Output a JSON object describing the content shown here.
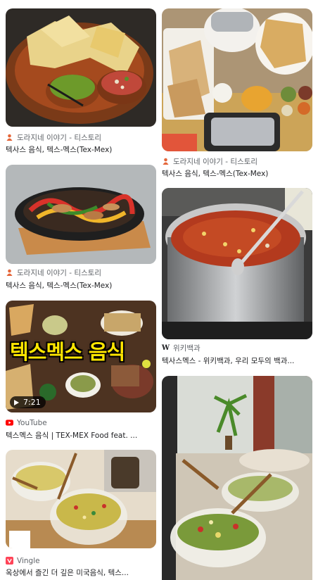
{
  "results": [
    {
      "source": "도라지네 이야기 - 티스토리",
      "title": "텍사스 음식, 텍스-멕스(Tex-Mex)",
      "favicon": "tistory-icon"
    },
    {
      "source": "도라지네 이야기 - 티스토리",
      "title": "텍사스 음식, 텍스-멕스(Tex-Mex)",
      "favicon": "tistory-icon"
    },
    {
      "source": "도라지네 이야기 - 티스토리",
      "title": "텍사스 음식, 텍스-멕스(Tex-Mex)",
      "favicon": "tistory-icon"
    },
    {
      "source": "위키백과",
      "title": "텍사스멕스 - 위키백과, 우리 모두의 백과...",
      "favicon": "wikipedia-icon",
      "favicon_glyph": "W"
    },
    {
      "source": "YouTube",
      "title": "텍스멕스 음식 | TEX-MEX Food feat. ...",
      "favicon": "youtube-icon",
      "duration": "7:21",
      "overlay_text": "텍스멕스 음식"
    },
    {
      "source": "Vingle",
      "title": "옥상에서 즐긴 더 깊은 미국음식, 텍스...",
      "favicon": "vingle-icon"
    }
  ],
  "colors": {
    "tistory": "#e4663a",
    "youtube": "#ff0000",
    "vingle": "#ff4458"
  }
}
